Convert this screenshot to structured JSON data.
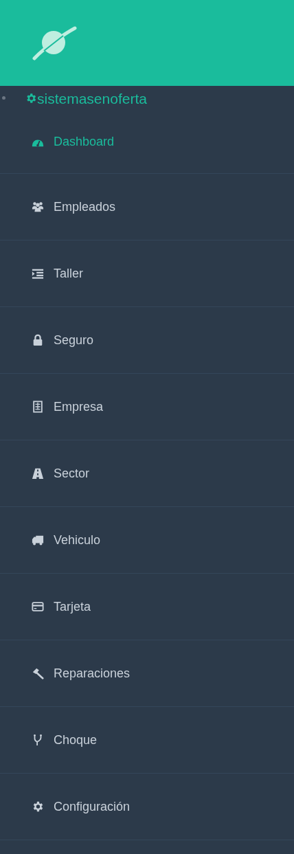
{
  "brand": {
    "label": "sistemasenoferta"
  },
  "menu": [
    {
      "label": "Dashboard",
      "selected": true
    },
    {
      "label": "Empleados",
      "selected": false
    },
    {
      "label": "Taller",
      "selected": false
    },
    {
      "label": "Seguro",
      "selected": false
    },
    {
      "label": "Empresa",
      "selected": false
    },
    {
      "label": "Sector",
      "selected": false
    },
    {
      "label": "Vehiculo",
      "selected": false
    },
    {
      "label": "Tarjeta",
      "selected": false
    },
    {
      "label": "Reparaciones",
      "selected": false
    },
    {
      "label": "Choque",
      "selected": false
    },
    {
      "label": "Configuración",
      "selected": false
    }
  ]
}
